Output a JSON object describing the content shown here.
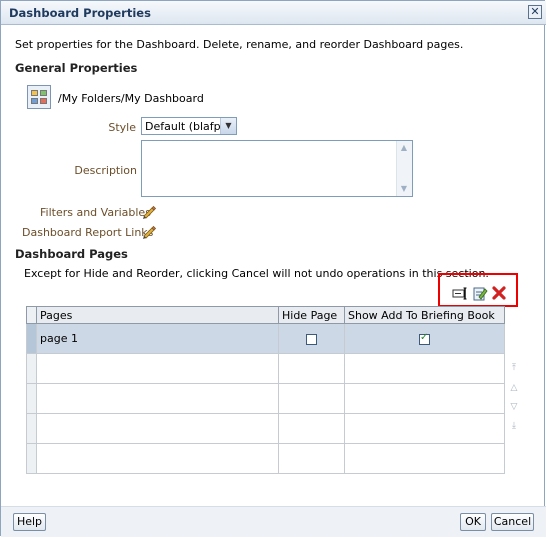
{
  "window": {
    "title": "Dashboard Properties",
    "close_glyph": "✕"
  },
  "intro_text": "Set properties for the Dashboard. Delete, rename, and reorder Dashboard pages.",
  "general": {
    "heading": "General Properties",
    "path": "/My Folders/My Dashboard",
    "style_label": "Style",
    "style_value": "Default (blafp)",
    "description_label": "Description",
    "description_value": "",
    "filters_link": "Filters and Variables",
    "report_links": "Dashboard Report Links"
  },
  "pages_section": {
    "heading": "Dashboard Pages",
    "note": "Except for Hide and Reorder, clicking Cancel will not undo operations in this section.",
    "toolbar_icons": [
      "rename-icon",
      "properties-icon",
      "delete-icon"
    ],
    "columns": [
      "Pages",
      "Hide Page",
      "Show Add To Briefing Book"
    ],
    "rows": [
      {
        "name": "page 1",
        "hide_page": false,
        "show_briefing": true
      }
    ],
    "reorder_icons": [
      "move-to-top-icon",
      "move-up-icon",
      "move-down-icon",
      "move-to-bottom-icon"
    ]
  },
  "buttons": {
    "help": "Help",
    "ok": "OK",
    "cancel": "Cancel"
  },
  "colors": {
    "title_bar": "#dde6f0",
    "selected_row": "#ccd8e6",
    "highlight_box": "#ee0000",
    "link_text": "#6b4e2a"
  }
}
